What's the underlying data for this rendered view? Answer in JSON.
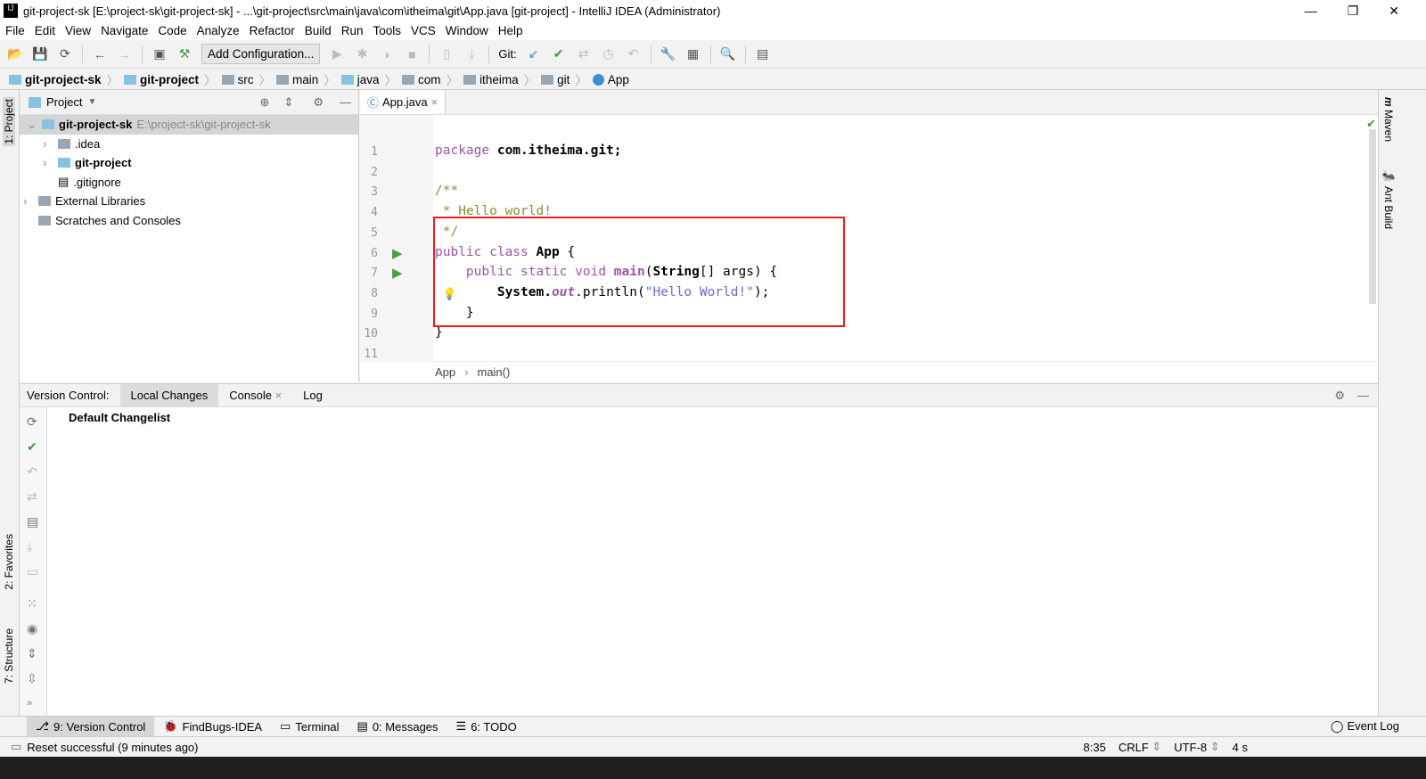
{
  "window": {
    "title": "git-project-sk [E:\\project-sk\\git-project-sk] - ...\\git-project\\src\\main\\java\\com\\itheima\\git\\App.java [git-project] - IntelliJ IDEA (Administrator)"
  },
  "menu": [
    "File",
    "Edit",
    "View",
    "Navigate",
    "Code",
    "Analyze",
    "Refactor",
    "Build",
    "Run",
    "Tools",
    "VCS",
    "Window",
    "Help"
  ],
  "toolbar": {
    "add_config": "Add Configuration...",
    "git_label": "Git:"
  },
  "breadcrumb": [
    {
      "label": "git-project-sk",
      "bold": true
    },
    {
      "label": "git-project",
      "bold": true
    },
    {
      "label": "src"
    },
    {
      "label": "main"
    },
    {
      "label": "java"
    },
    {
      "label": "com"
    },
    {
      "label": "itheima"
    },
    {
      "label": "git"
    },
    {
      "label": "App"
    }
  ],
  "left_strip": {
    "project": "1: Project",
    "favorites": "2: Favorites",
    "structure": "7: Structure"
  },
  "right_strip": {
    "maven": "Maven",
    "ant": "Ant Build"
  },
  "project": {
    "title": "Project",
    "tree": [
      {
        "label": "git-project-sk",
        "path": "E:\\project-sk\\git-project-sk",
        "bold": true
      },
      {
        "label": ".idea"
      },
      {
        "label": "git-project",
        "bold": true
      },
      {
        "label": ".gitignore"
      },
      {
        "label": "External Libraries"
      },
      {
        "label": "Scratches and Consoles"
      }
    ]
  },
  "editor": {
    "tab": "App.java",
    "lines": [
      "1",
      "2",
      "3",
      "4",
      "5",
      "6",
      "7",
      "8",
      "9",
      "10",
      "11"
    ],
    "breadcrumb": [
      "App",
      "main()"
    ],
    "code": {
      "l1a": "package",
      "l1b": " com.itheima.git;",
      "l3": "/**",
      "l4": " * Hello world!",
      "l5": " */",
      "l6a": "public class ",
      "l6b": "App",
      "l6c": " {",
      "l7a": "    public static void ",
      "l7b": "main",
      "l7c": "(",
      "l7d": "String",
      "l7e": "[] args) {",
      "l8a": "        System.",
      "l8b": "out",
      "l8c": ".println(",
      "l8d": "\"Hello World!\"",
      "l8e": ");",
      "l9": "    }",
      "l10": "}"
    }
  },
  "vc": {
    "label": "Version Control:",
    "tabs": [
      "Local Changes",
      "Console",
      "Log"
    ],
    "changelist": "Default Changelist"
  },
  "toolwindows": [
    {
      "label": "9: Version Control"
    },
    {
      "label": "FindBugs-IDEA"
    },
    {
      "label": "Terminal"
    },
    {
      "label": "0: Messages"
    },
    {
      "label": "6: TODO"
    }
  ],
  "event_log": "Event Log",
  "status": {
    "message": "Reset successful (9 minutes ago)",
    "position": "8:35",
    "line_sep": "CRLF",
    "encoding": "UTF-8",
    "indent": "4 s"
  },
  "colors": {
    "keyword": "#9b57a8",
    "string": "#6a6adb",
    "comment": "#8c8c3a",
    "highlight_box": "#f21a1a"
  }
}
